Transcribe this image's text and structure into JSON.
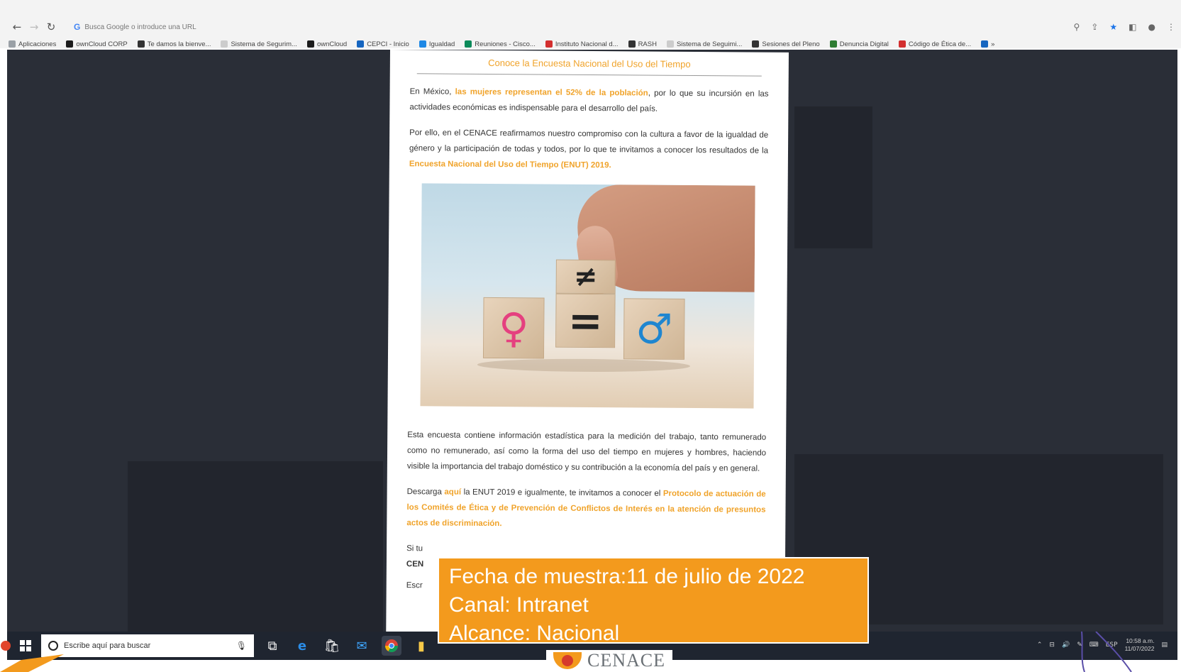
{
  "browser": {
    "address_placeholder": "Busca Google o introduce una URL",
    "bookmarks": [
      {
        "label": "Aplicaciones",
        "color": "#9aa0a6"
      },
      {
        "label": "ownCloud CORP",
        "color": "#1c1c1c"
      },
      {
        "label": "Te damos la bienve...",
        "color": "#333333"
      },
      {
        "label": "Sistema de Segurim...",
        "color": "#cccccc"
      },
      {
        "label": "ownCloud",
        "color": "#1c1c1c"
      },
      {
        "label": "CEPCI - Inicio",
        "color": "#1565c0"
      },
      {
        "label": "Igualdad",
        "color": "#1e88e5"
      },
      {
        "label": "Reuniones - Cisco...",
        "color": "#0b8a5a"
      },
      {
        "label": "Instituto Nacional d...",
        "color": "#d32f2f"
      },
      {
        "label": "RASH",
        "color": "#333333"
      },
      {
        "label": "Sistema de Seguimi...",
        "color": "#cccccc"
      },
      {
        "label": "Sesiones del Pleno",
        "color": "#333333"
      },
      {
        "label": "Denuncia Digital",
        "color": "#2e7d32"
      },
      {
        "label": "Código de Ética de...",
        "color": "#d32f2f"
      },
      {
        "label": "»",
        "color": "#1565c0"
      }
    ]
  },
  "article": {
    "title": "Conoce la Encuesta Nacional del Uso del Tiempo",
    "p1_a": "En México, ",
    "p1_hl": "las mujeres representan el 52% de la población",
    "p1_b": ", por lo que su incursión en las actividades económicas es indispensable para el desarrollo del país.",
    "p2_a": "Por ello, en el CENACE reafirmamos nuestro compromiso con la cultura a favor de la igualdad de género y la participación de todas y todos, por lo que te invitamos a conocer los resultados de la ",
    "p2_hl": "Encuesta Nacional del Uso del Tiempo (ENUT) 2019.",
    "p3": "Esta encuesta contiene información estadística para la medición del trabajo, tanto remunerado como no remunerado, así como la forma del uso del tiempo en mujeres y hombres, haciendo visible la importancia del trabajo doméstico y su contribución a la economía del país y en general.",
    "p4_a": "Descarga ",
    "p4_hl1": "aquí",
    "p4_b": " la ENUT 2019 e igualmente, te invitamos a conocer el ",
    "p4_hl2": "Protocolo de actuación de los Comités de Ética y de Prevención de Conflictos de Interés en la atención de presuntos actos de discriminación.",
    "p5_start": "Si tu",
    "p5_bold": "CEN",
    "p6_start": "Escr",
    "cube_left": "♀",
    "cube_top": "≠",
    "cube_mid": "=",
    "cube_right": "♂",
    "colors": {
      "accent": "#f0a32a",
      "female": "#e5407f",
      "male": "#1f86d0"
    }
  },
  "sticker": {
    "line1": "Fecha de muestra:11 de julio de 2022",
    "line2": "Canal: Intranet",
    "line3": "Alcance: Nacional",
    "color": "#f39a1d"
  },
  "taskbar": {
    "search_placeholder": "Escribe aquí para buscar",
    "lang": "ESP",
    "time": "10:58 a.m.",
    "date": "11/07/2022"
  },
  "footer": {
    "logo_text": "CENACE"
  }
}
